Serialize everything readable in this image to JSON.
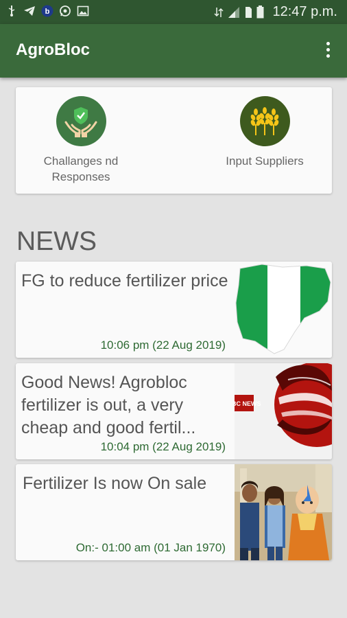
{
  "status_bar": {
    "time": "12:47 p.m.",
    "left_icons": [
      "usb-icon",
      "telegram-icon",
      "b-app-icon",
      "whatsapp-icon",
      "gallery-icon"
    ],
    "b_icon_letter": "b",
    "right_icons": [
      "data-icon",
      "signal-icon",
      "sim-icon",
      "battery-icon"
    ]
  },
  "app_bar": {
    "title": "AgroBloc",
    "menu_icon": "more-vert-icon"
  },
  "categories": [
    {
      "label": "Challanges nd Responses",
      "icon": "shield-hands-icon",
      "color": "#3f7a44"
    },
    {
      "label": "Input Suppliers",
      "icon": "wheat-icon",
      "color": "#3e5a1e"
    }
  ],
  "news_heading": "NEWS",
  "news": [
    {
      "title": "FG to reduce fertilizer price",
      "date": "10:06 pm (22 Aug 2019)",
      "image": "nigeria-flag-map-image"
    },
    {
      "title": "Good News! Agrobloc fertilizer is out, a very cheap and good fertil...",
      "date": "10:04 pm (22 Aug 2019)",
      "image": "bbc-news-image",
      "image_text": "BBC NEWS"
    },
    {
      "title": "Fertilizer Is now On sale",
      "date": "On:- 01:00 am (01 Jan 1970)",
      "image": "cartoon-characters-image"
    }
  ],
  "colors": {
    "status_bar": "#2f5630",
    "app_bar": "#3a6a3b",
    "date_text": "#2e6a33",
    "background": "#e3e3e3"
  }
}
